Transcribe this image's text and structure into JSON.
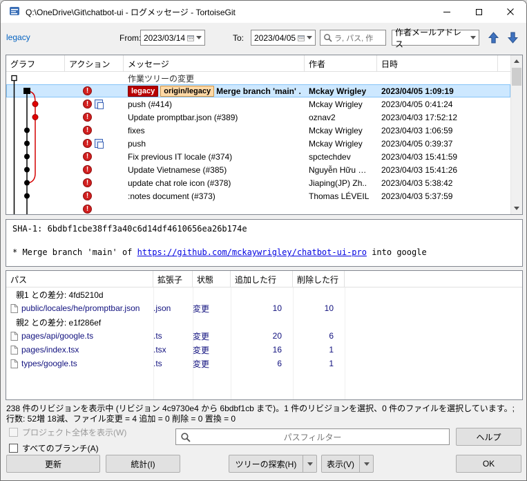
{
  "window": {
    "title": "Q:\\OneDrive\\Git\\chatbot-ui - ログメッセージ - TortoiseGit"
  },
  "toolbar": {
    "branch_link": "legacy",
    "from_label": "From:",
    "from_value": "2023/03/14",
    "to_label": "To:",
    "to_value": "2023/04/05",
    "search_placeholder": "ラ, パス, 作",
    "author_filter_value": "作者メールアドレス"
  },
  "log": {
    "columns": [
      "グラフ",
      "アクション",
      "メッセージ",
      "作者",
      "日時"
    ],
    "worktree_label": "作業ツリーの変更",
    "rows": [
      {
        "selected": true,
        "icons": [
          "modified"
        ],
        "tags": [
          {
            "label": "legacy",
            "kind": "local"
          },
          {
            "label": "origin/legacy",
            "kind": "remote"
          }
        ],
        "message": "Merge branch 'main' …",
        "author": "Mckay Wrigley",
        "date": "2023/04/05 1:09:19"
      },
      {
        "icons": [
          "modified",
          "copied"
        ],
        "message": "push (#414)",
        "author": "Mckay Wrigley",
        "date": "2023/04/05 0:41:24"
      },
      {
        "icons": [
          "modified"
        ],
        "message": "Update promptbar.json (#389)",
        "author": "oznav2",
        "date": "2023/04/03 17:52:12"
      },
      {
        "icons": [
          "modified"
        ],
        "message": "fixes",
        "author": "Mckay Wrigley",
        "date": "2023/04/03 1:06:59"
      },
      {
        "icons": [
          "modified",
          "copied"
        ],
        "message": "push",
        "author": "Mckay Wrigley",
        "date": "2023/04/05 0:39:37"
      },
      {
        "icons": [
          "modified"
        ],
        "message": "Fix previous IT locale (#374)",
        "author": "spctechdev",
        "date": "2023/04/03 15:41:59"
      },
      {
        "icons": [
          "modified"
        ],
        "message": "Update Vietnamese (#385)",
        "author": "Nguyễn Hữu …",
        "date": "2023/04/03 15:41:26"
      },
      {
        "icons": [
          "modified"
        ],
        "message": "update chat role icon (#378)",
        "author": "Jiaping(JP) Zh..",
        "date": "2023/04/03 5:38:42"
      },
      {
        "icons": [
          "modified"
        ],
        "message": ":notes document (#373)",
        "author": "Thomas LÉVEIL",
        "date": "2023/04/03 5:37:59"
      },
      {
        "icons": [
          "modified"
        ],
        "message": "",
        "author": "",
        "date": ""
      }
    ]
  },
  "detail": {
    "sha_line": "SHA-1: 6bdbf1cbe38ff3a40c6d14df4610656ea26b174e",
    "message_prefix": "* Merge branch 'main' of ",
    "message_link": "https://github.com/mckaywrigley/chatbot-ui-pro",
    "message_suffix": " into google"
  },
  "files": {
    "columns": [
      "パス",
      "拡張子",
      "状態",
      "追加した行",
      "削除した行"
    ],
    "rows": [
      {
        "kind": "group",
        "path": "親1 との差分: 4fd5210d"
      },
      {
        "kind": "file",
        "path": "public/locales/he/promptbar.json",
        "ext": ".json",
        "status": "変更",
        "added": "10",
        "deleted": "10"
      },
      {
        "kind": "group",
        "path": "親2 との差分: e1f286ef"
      },
      {
        "kind": "file",
        "path": "pages/api/google.ts",
        "ext": ".ts",
        "status": "変更",
        "added": "20",
        "deleted": "6"
      },
      {
        "kind": "file",
        "path": "pages/index.tsx",
        "ext": ".tsx",
        "status": "変更",
        "added": "16",
        "deleted": "1"
      },
      {
        "kind": "file",
        "path": "types/google.ts",
        "ext": ".ts",
        "status": "変更",
        "added": "6",
        "deleted": "1"
      }
    ]
  },
  "status": {
    "text": "238 件のリビジョンを表示中 (リビジョン 4c9730e4 から 6bdbf1cb まで)。1 件のリビジョンを選択、0 件のファイルを選択しています。; 行数: 52増 18減、ファイル変更 = 4 追加 = 0 削除 = 0 置換 = 0"
  },
  "footer": {
    "show_whole_project": "プロジェクト全体を表示(W)",
    "all_branches": "すべてのブランチ(A)",
    "path_filter_placeholder": "パスフィルター",
    "help": "ヘルプ",
    "refresh": "更新",
    "statistics": "統計(I)",
    "walk_behavior": "ツリーの探索(H)",
    "view": "表示(V)",
    "ok": "OK"
  },
  "colors": {
    "selection_bg": "#cde8ff",
    "local_tag_bg": "#b80000",
    "remote_tag_bg": "#ffd9a6",
    "graph_branch_red": "#d40000",
    "link_blue": "#0000e0"
  }
}
